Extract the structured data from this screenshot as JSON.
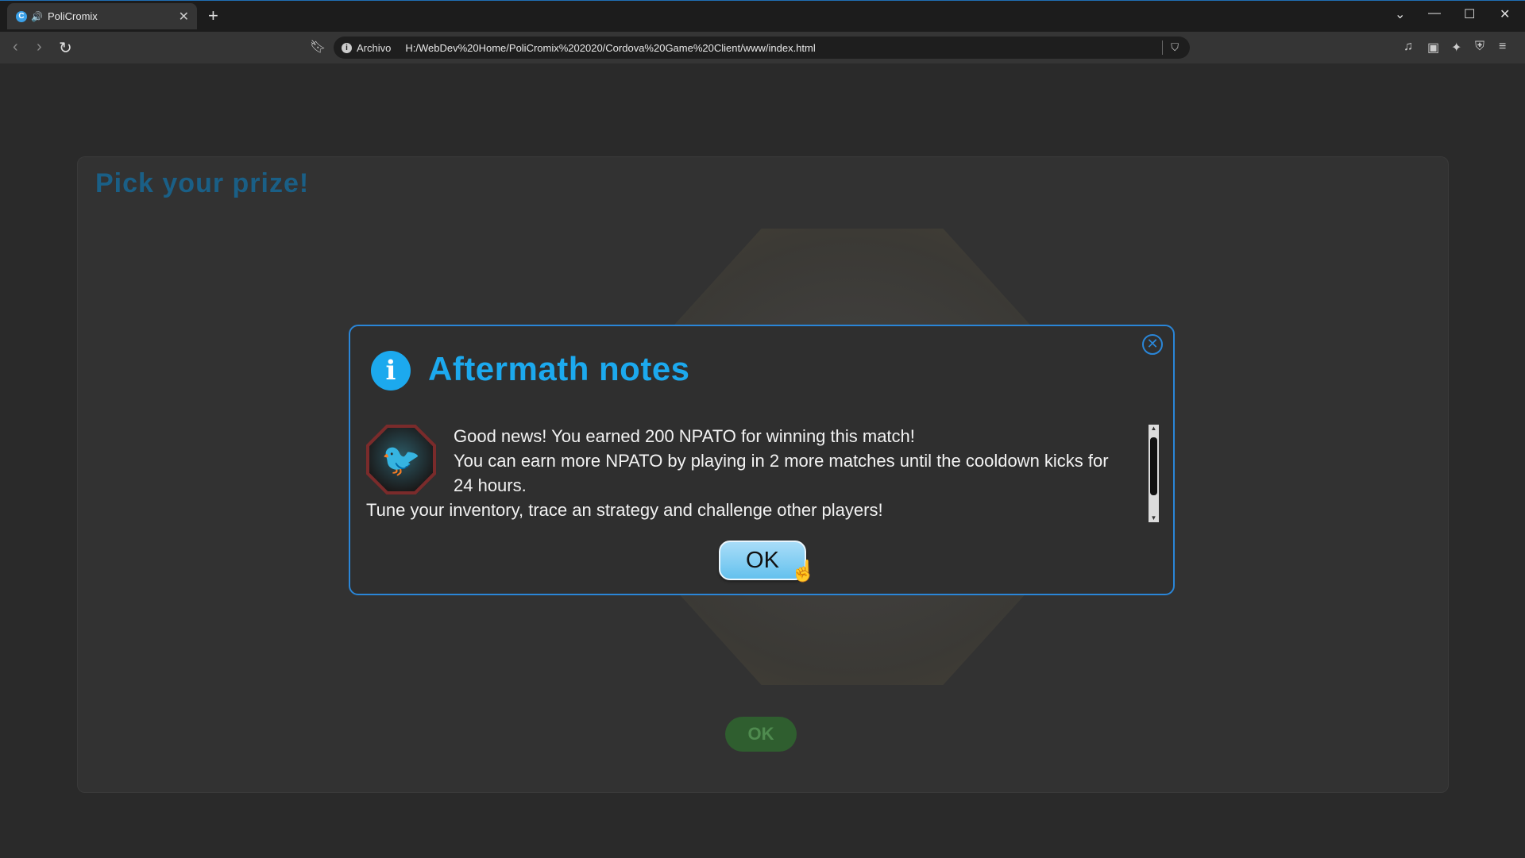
{
  "browser": {
    "tab_title": "PoliCromix",
    "tab_favicon": "C",
    "tab_speaker_icon": "🔊",
    "new_tab_label": "+",
    "scheme_label": "Archivo",
    "url": "H:/WebDev%20Home/PoliCromix%202020/Cordova%20Game%20Client/www/index.html"
  },
  "background": {
    "title": "Pick your prize!",
    "ok_label": "OK"
  },
  "dialog": {
    "title": "Aftermath notes",
    "info_icon": "i",
    "close_icon": "✕",
    "messages": [
      "Good news! You earned 200 NPATO for winning this match!",
      "You can earn more NPATO by playing in 2 more matches until the cooldown kicks for 24 hours.",
      "Tune your inventory, trace an strategy and challenge other players!"
    ],
    "ok_label": "OK"
  },
  "colors": {
    "accent": "#1ca9ee",
    "border": "#2a86d8"
  }
}
